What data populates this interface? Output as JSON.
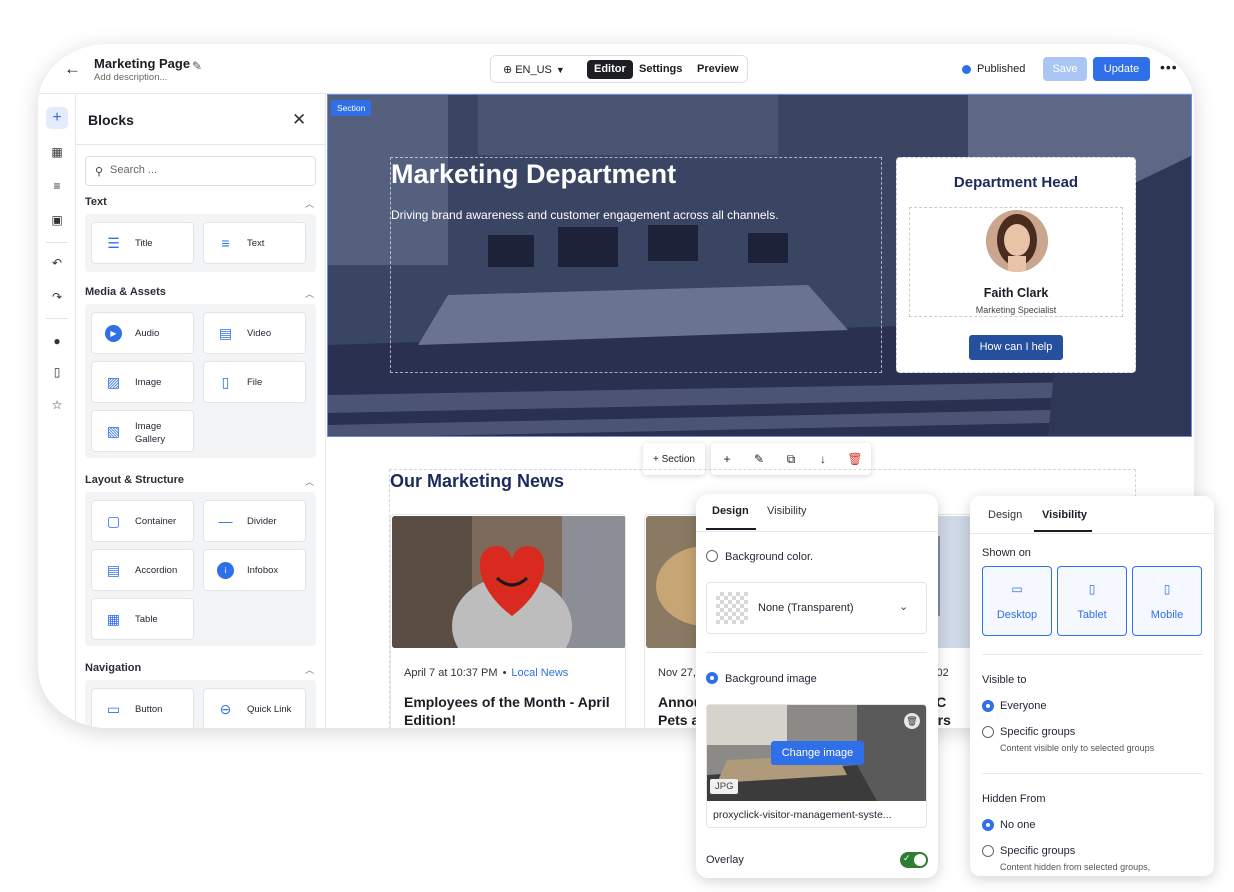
{
  "header": {
    "page_title": "Marketing Page",
    "page_description": "Add description...",
    "language": "EN_US",
    "tabs": [
      "Editor",
      "Settings",
      "Preview"
    ],
    "status": "Published",
    "save_label": "Save",
    "update_label": "Update",
    "more_label": "•••"
  },
  "rail": {
    "icons": [
      "plus-icon",
      "blocks-grid-icon",
      "layers-icon",
      "media-icon",
      "undo-icon",
      "redo-icon",
      "help-icon",
      "pages-icon",
      "favorites-icon"
    ]
  },
  "blocks_panel": {
    "title": "Blocks",
    "search_placeholder": "Search ...",
    "categories": [
      {
        "name": "Text",
        "items": [
          "Title",
          "Text"
        ]
      },
      {
        "name": "Media & Assets",
        "items": [
          "Audio",
          "Video",
          "Image",
          "File",
          "Image Gallery"
        ]
      },
      {
        "name": "Layout & Structure",
        "items": [
          "Container",
          "Divider",
          "Accordion",
          "Infobox",
          "Table"
        ]
      },
      {
        "name": "Navigation",
        "items": [
          "Button",
          "Quick Link"
        ]
      }
    ]
  },
  "canvas": {
    "section_tag": "Section",
    "hero_title": "Marketing Department",
    "hero_subtitle": "Driving brand awareness and customer engagement across all channels.",
    "dept_card": {
      "title": "Department Head",
      "name": "Faith Clark",
      "role": "Marketing Specialist",
      "button": "How can I help"
    },
    "toolbar": {
      "section_label": "Section"
    },
    "news_title": "Our Marketing News",
    "news": [
      {
        "date": "April 7 at 10:37 PM",
        "category": "Local News",
        "headline": "Employees of the Month - April Edition!"
      },
      {
        "date": "Nov 27,",
        "headline_l1": "Annou",
        "headline_l2": "Pets a"
      },
      {
        "date": "24, 202",
        "headline_l1": "ate C",
        "headline_l2": "nburs"
      }
    ]
  },
  "design_popover": {
    "tabs": [
      "Design",
      "Visibility"
    ],
    "bg_color_label": "Background color.",
    "bg_color_value": "None (Transparent)",
    "bg_image_label": "Background image",
    "change_image": "Change image",
    "file_type": "JPG",
    "file_name": "proxyclick-visitor-management-syste...",
    "overlay_label": "Overlay",
    "overlay_on": true
  },
  "visibility_popover": {
    "tabs": [
      "Design",
      "Visibility"
    ],
    "shown_on_label": "Shown on",
    "devices": [
      "Desktop",
      "Tablet",
      "Mobile"
    ],
    "visible_to_label": "Visible to",
    "visible_options": [
      {
        "label": "Everyone",
        "selected": true
      },
      {
        "label": "Specific groups",
        "sub": "Content visible only to selected groups",
        "selected": false
      }
    ],
    "hidden_from_label": "Hidden From",
    "hidden_options": [
      {
        "label": "No one",
        "selected": true
      },
      {
        "label": "Specific groups",
        "sub": "Content hidden from selected groups,",
        "selected": false
      }
    ]
  },
  "colors": {
    "accent": "#2f6fe8",
    "dark_button": "#24509e",
    "navy_text": "#1c2a5c",
    "toggle_on": "#2e7d32",
    "delete": "#d4352b"
  }
}
